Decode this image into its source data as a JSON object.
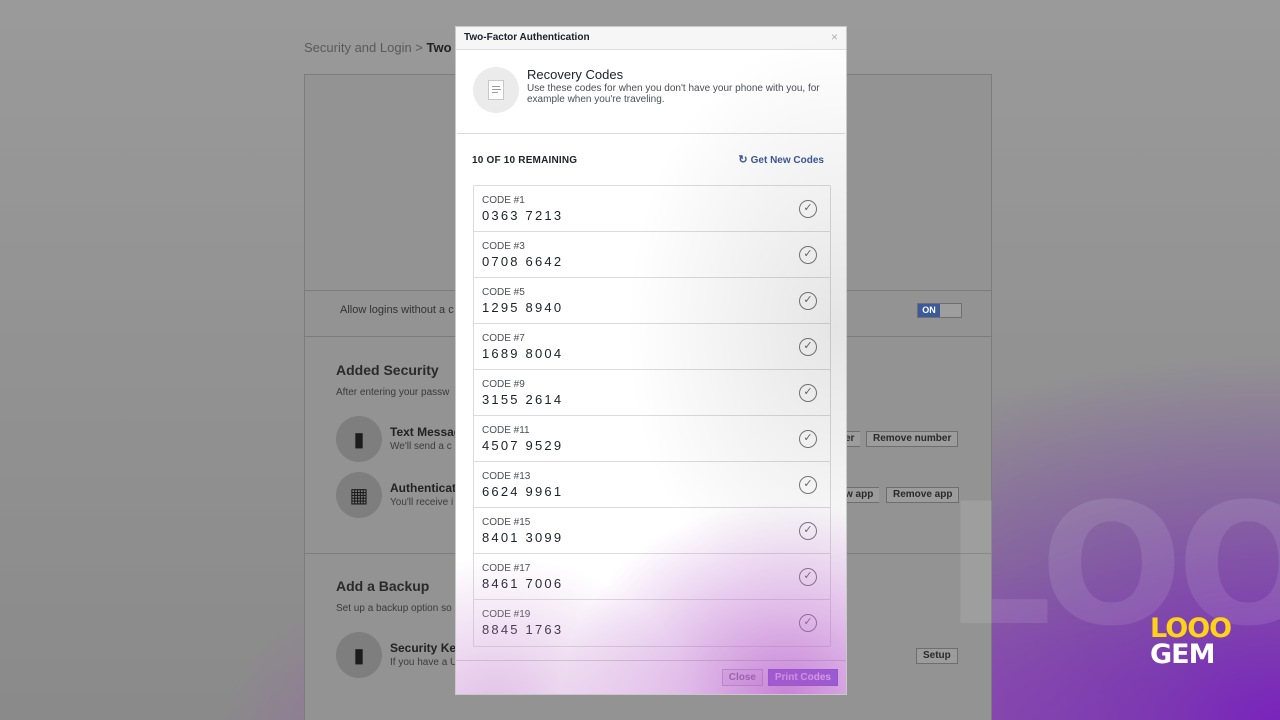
{
  "background_page": {
    "breadcrumb_parent": "Security and Login >",
    "breadcrumb_current": "Two",
    "allow_logins_text": "Allow logins without a c",
    "toggle_label": "ON",
    "added_security": {
      "title": "Added Security",
      "subtitle": "After entering your passw",
      "options": [
        {
          "title": "Text Messag",
          "subtitle": "We'll send a c",
          "button_a": "er",
          "button_b": "Remove number"
        },
        {
          "title": "Authenticati",
          "subtitle": "You'll receive i",
          "button_a": "w app",
          "button_b": "Remove app"
        }
      ]
    },
    "add_backup": {
      "title": "Add a Backup",
      "subtitle": "Set up a backup option so",
      "option_title": "Security Ke",
      "option_subtitle": "If you have a U",
      "setup_button": "Setup"
    }
  },
  "modal": {
    "title": "Two-Factor Authentication",
    "close_glyph": "×",
    "recovery": {
      "title": "Recovery Codes",
      "subtitle": "Use these codes for when you don't have your phone with you, for example when you're traveling."
    },
    "remaining_text": "10 OF 10 REMAINING",
    "get_new_codes": "Get New Codes",
    "codes": [
      {
        "label": "CODE #1",
        "value": "0363 7213"
      },
      {
        "label": "CODE #3",
        "value": "0708 6642"
      },
      {
        "label": "CODE #5",
        "value": "1295 8940"
      },
      {
        "label": "CODE #7",
        "value": "1689 8004"
      },
      {
        "label": "CODE #9",
        "value": "3155 2614"
      },
      {
        "label": "CODE #11",
        "value": "4507 9529"
      },
      {
        "label": "CODE #13",
        "value": "6624 9961"
      },
      {
        "label": "CODE #15",
        "value": "8401 3099"
      },
      {
        "label": "CODE #17",
        "value": "8461 7006"
      },
      {
        "label": "CODE #19",
        "value": "8845 1763"
      }
    ],
    "footer": {
      "close_label": "Close",
      "print_label": "Print Codes"
    }
  },
  "watermark": {
    "logo_line1": "LOOO",
    "logo_line2": "GEM"
  },
  "colors": {
    "link_blue": "#3b5998",
    "primary_button": "#7b58e0",
    "overlay_gray": "#8e8e8e"
  }
}
